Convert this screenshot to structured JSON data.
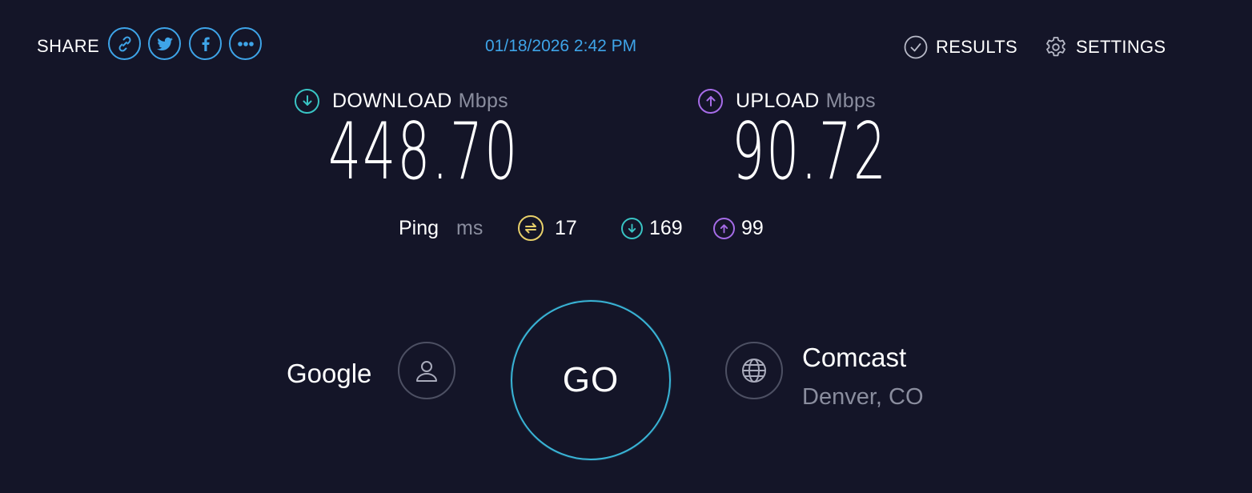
{
  "share": {
    "label": "SHARE",
    "buttons": [
      {
        "icon": "link-icon"
      },
      {
        "icon": "twitter-icon"
      },
      {
        "icon": "facebook-icon"
      },
      {
        "icon": "more-icon"
      }
    ]
  },
  "timestamp": "01/18/2026 2:42 PM",
  "nav": {
    "results_label": "RESULTS",
    "settings_label": "SETTINGS"
  },
  "download": {
    "label": "DOWNLOAD",
    "unit": "Mbps",
    "value": "448.70",
    "icon": "arrow-down-icon",
    "color": "#39c4c4"
  },
  "upload": {
    "label": "UPLOAD",
    "unit": "Mbps",
    "value": "90.72",
    "icon": "arrow-up-icon",
    "color": "#a66ce8"
  },
  "ping": {
    "label": "Ping",
    "unit": "ms",
    "idle": {
      "value": "17",
      "icon": "ping-icon",
      "color": "#e8d06a"
    },
    "download": {
      "value": "169",
      "icon": "arrow-down-icon",
      "color": "#39c4c4"
    },
    "upload": {
      "value": "99",
      "icon": "arrow-up-icon",
      "color": "#a66ce8"
    }
  },
  "host": {
    "name": "Google",
    "icon": "user-icon"
  },
  "go_label": "GO",
  "isp": {
    "name": "Comcast",
    "location": "Denver, CO",
    "icon": "globe-icon"
  },
  "colors": {
    "background": "#141528",
    "accent": "#3ea4e8",
    "go_ring": "#39b4d6",
    "muted": "#8a8d9e"
  }
}
